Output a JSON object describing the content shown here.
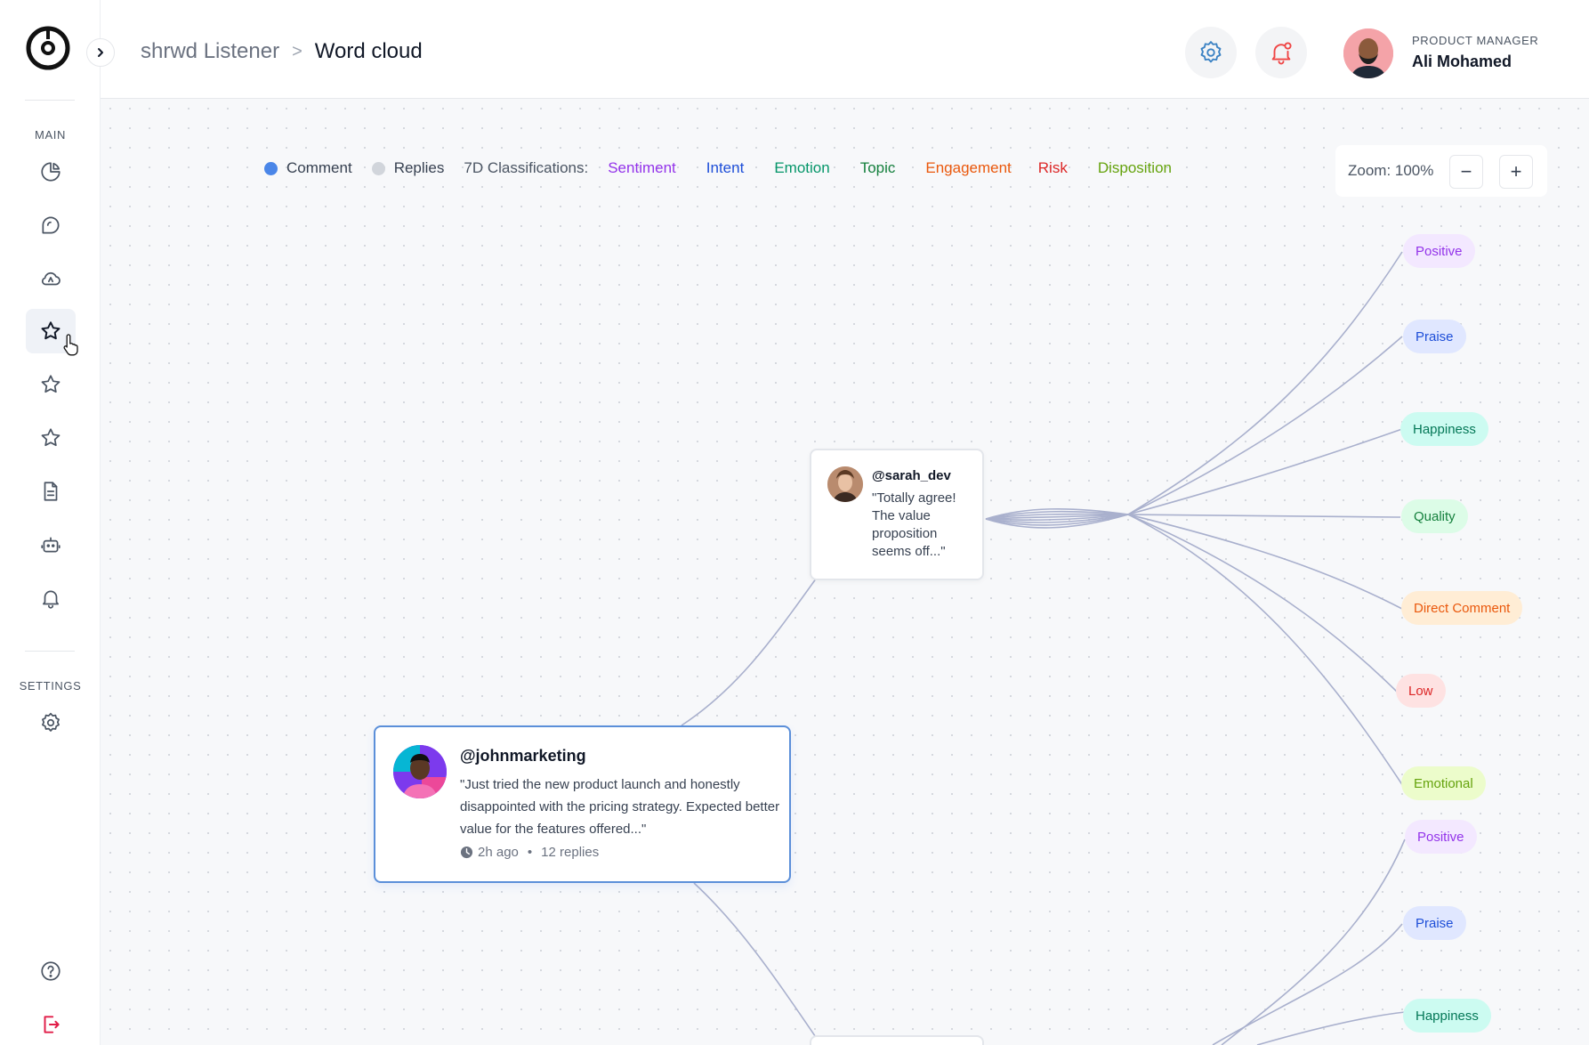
{
  "app": {
    "breadcrumb": [
      "shrwd Listener",
      "Word cloud"
    ],
    "breadcrumb_sep": ">"
  },
  "sidebar": {
    "section_main": "MAIN",
    "section_settings": "SETTINGS",
    "items": [
      {
        "icon": "pie-chart-icon"
      },
      {
        "icon": "chat-bubble-icon"
      },
      {
        "icon": "cloud-icon"
      },
      {
        "icon": "star-icon",
        "active": true
      },
      {
        "icon": "star-icon"
      },
      {
        "icon": "star-icon"
      },
      {
        "icon": "document-icon"
      },
      {
        "icon": "bot-icon"
      },
      {
        "icon": "bell-icon"
      }
    ],
    "settings_icon": "gear-icon",
    "footer": [
      "help-icon",
      "logout-icon"
    ]
  },
  "user": {
    "role": "PRODUCT MANAGER",
    "name": "Ali Mohamed"
  },
  "legend": {
    "comment": "Comment",
    "replies": "Replies",
    "classifications_label": "7D Classifications:",
    "classes": [
      {
        "label": "Sentiment",
        "color": "#9333ea"
      },
      {
        "label": "Intent",
        "color": "#1d4ed8"
      },
      {
        "label": "Emotion",
        "color": "#059669"
      },
      {
        "label": "Topic",
        "color": "#15803d"
      },
      {
        "label": "Engagement",
        "color": "#ea580c"
      },
      {
        "label": "Risk",
        "color": "#dc2626"
      },
      {
        "label": "Disposition",
        "color": "#65a30d"
      }
    ],
    "comment_color": "#4a86e8",
    "replies_color": "#d1d5db"
  },
  "zoom": {
    "label": "Zoom: 100%",
    "minus": "−",
    "plus": "+"
  },
  "comment": {
    "handle": "@johnmarketing",
    "text": "\"Just tried the new product launch and honestly disappointed with the pricing strategy. Expected better value for the features offered...\"",
    "time": "2h ago",
    "replies": "12 replies"
  },
  "reply": {
    "handle": "@sarah_dev",
    "text": "\"Totally agree! The value proposition seems off...\""
  },
  "tags_reply": [
    {
      "label": "Positive",
      "bg": "#f3e8ff",
      "color": "#9333ea"
    },
    {
      "label": "Praise",
      "bg": "#e0e7ff",
      "color": "#1d4ed8"
    },
    {
      "label": "Happiness",
      "bg": "#ccfbf1",
      "color": "#047857"
    },
    {
      "label": "Quality",
      "bg": "#dcfce7",
      "color": "#15803d"
    },
    {
      "label": "Direct Comment",
      "bg": "#ffedd5",
      "color": "#ea580c"
    },
    {
      "label": "Low",
      "bg": "#fee2e2",
      "color": "#dc2626"
    },
    {
      "label": "Emotional",
      "bg": "#ecfccb",
      "color": "#65a30d"
    }
  ],
  "tags_next": [
    {
      "label": "Positive",
      "bg": "#f3e8ff",
      "color": "#9333ea"
    },
    {
      "label": "Praise",
      "bg": "#e0e7ff",
      "color": "#1d4ed8"
    },
    {
      "label": "Happiness",
      "bg": "#ccfbf1",
      "color": "#047857"
    }
  ]
}
